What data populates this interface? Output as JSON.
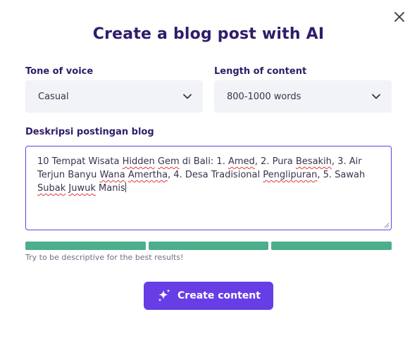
{
  "dialog": {
    "title": "Create a blog post with AI",
    "close_icon": "close-icon"
  },
  "tone": {
    "label": "Tone of voice",
    "value": "Casual",
    "icon": "chevron-down-icon"
  },
  "length": {
    "label": "Length of content",
    "value": "800-1000 words",
    "icon": "chevron-down-icon"
  },
  "description": {
    "label": "Deskripsi postingan blog",
    "value": "10 Tempat Wisata Hidden Gem di Bali: 1. Amed, 2. Pura Besakih, 3. Air Terjun Banyu Wana Amertha, 4. Desa Tradisional Penglipuran, 5. Sawah Subak Juwuk Manis",
    "parts": [
      {
        "t": "10 Tempat Wisata ",
        "s": false
      },
      {
        "t": "Hidden",
        "s": true
      },
      {
        "t": " ",
        "s": false
      },
      {
        "t": "Gem",
        "s": true
      },
      {
        "t": " di Bali: 1. ",
        "s": false
      },
      {
        "t": "Amed",
        "s": true
      },
      {
        "t": ", 2. Pura ",
        "s": false
      },
      {
        "t": "Besakih",
        "s": true
      },
      {
        "t": ", 3. Air Terjun Banyu ",
        "s": false
      },
      {
        "t": "Wana",
        "s": true
      },
      {
        "t": " ",
        "s": false
      },
      {
        "t": "Amertha",
        "s": true
      },
      {
        "t": ", 4. Desa Tradisional ",
        "s": false
      },
      {
        "t": "Penglipuran",
        "s": true
      },
      {
        "t": ", 5. Sawah ",
        "s": false
      },
      {
        "t": "Subak",
        "s": true
      },
      {
        "t": " ",
        "s": false
      },
      {
        "t": "Juwuk",
        "s": true
      },
      {
        "t": " Manis",
        "s": false
      }
    ],
    "quality": {
      "filled_segments": 3,
      "total_segments": 3,
      "color": "#4cae8a"
    },
    "hint": "Try to be descriptive for the best results!"
  },
  "cta": {
    "label": "Create content",
    "icon": "sparkle-icon"
  },
  "colors": {
    "accent": "#673de6",
    "heading": "#2f1c6a",
    "input_bg": "#f2f3f6",
    "success": "#4cae8a",
    "spellcheck": "#e03a3a"
  }
}
